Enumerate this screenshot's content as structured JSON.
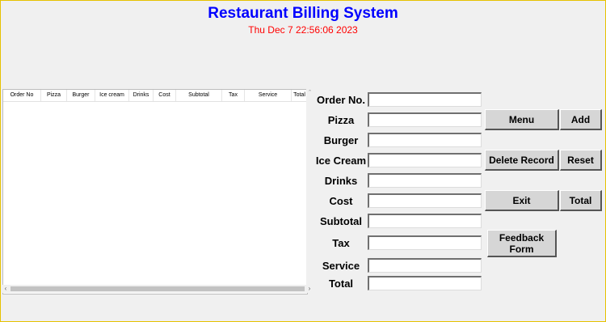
{
  "app": {
    "title": "Restaurant Billing System",
    "datetime": "Thu Dec  7 22:56:06 2023"
  },
  "table": {
    "columns": [
      "Order No",
      "Pizza",
      "Burger",
      "Ice cream",
      "Drinks",
      "Cost",
      "Subtotal",
      "Tax",
      "Service",
      "Total"
    ],
    "rows": []
  },
  "form": {
    "order_no_label": "Order No.",
    "pizza_label": "Pizza",
    "burger_label": "Burger",
    "ice_cream_label": "Ice Cream",
    "drinks_label": "Drinks",
    "cost_label": "Cost",
    "subtotal_label": "Subtotal",
    "tax_label": "Tax",
    "service_label": "Service",
    "total_label": "Total",
    "values": {
      "order_no": "",
      "pizza": "",
      "burger": "",
      "ice_cream": "",
      "drinks": "",
      "cost": "",
      "subtotal": "",
      "tax": "",
      "service": "",
      "total": ""
    }
  },
  "buttons": {
    "menu": "Menu",
    "add": "Add",
    "delete_record": "Delete Record",
    "reset": "Reset",
    "exit": "Exit",
    "total": "Total",
    "feedback": "Feedback Form"
  },
  "colors": {
    "title": "#0000ff",
    "datetime": "#ff0000",
    "background": "#f0f0f0"
  }
}
